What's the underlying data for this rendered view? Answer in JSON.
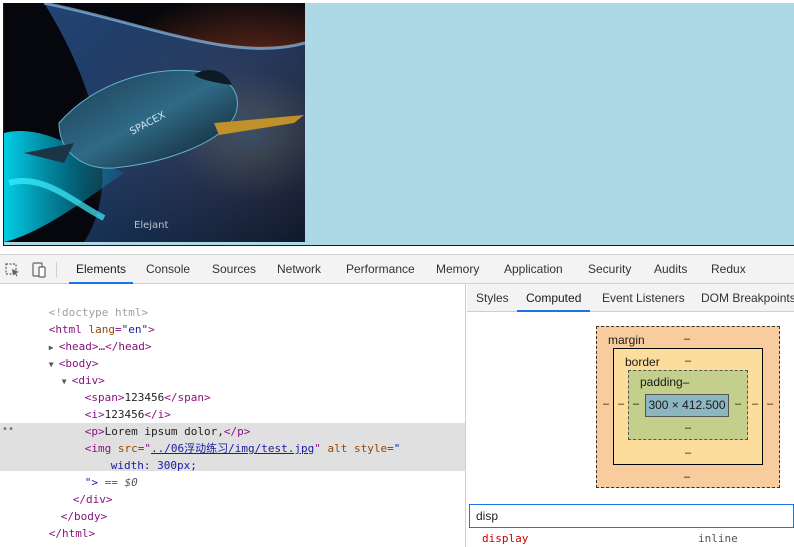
{
  "page": {
    "image_caption_text": "Elejant"
  },
  "devtools": {
    "tabs": [
      {
        "label": "Elements",
        "active": true
      },
      {
        "label": "Console",
        "active": false
      },
      {
        "label": "Sources",
        "active": false
      },
      {
        "label": "Network",
        "active": false
      },
      {
        "label": "Performance",
        "active": false
      },
      {
        "label": "Memory",
        "active": false
      },
      {
        "label": "Application",
        "active": false
      },
      {
        "label": "Security",
        "active": false
      },
      {
        "label": "Audits",
        "active": false
      },
      {
        "label": "Redux",
        "active": false
      }
    ],
    "icons": {
      "inspect": "inspect-element-icon",
      "device": "device-toolbar-icon"
    },
    "accent_color": "#1a73e8"
  },
  "elements": {
    "doctype": "<!doctype html>",
    "html_open_tag": "html",
    "html_lang_attr": "lang",
    "html_lang_val": "\"en\"",
    "head_collapsed": "<head>…</head>",
    "body_open": "<body>",
    "div_open": "<div>",
    "span_line": {
      "open": "<span>",
      "text": "123456",
      "close": "</span>"
    },
    "i_line": {
      "open": "<i>",
      "text": "123456",
      "close": "</i>"
    },
    "p_line": {
      "open": "<p>",
      "text": "Lorem ipsum dolor,",
      "close": "</p>"
    },
    "img_line": {
      "open": "<img",
      "src_attr": "src",
      "src_val": "../06浮动练习/img/test.jpg",
      "alt_attr": "alt",
      "style_attr": "style",
      "style_val_open": "\"",
      "style_body": "width: 300px;",
      "style_close": "\">",
      "selected_marker": "== $0"
    },
    "div_close": "</div>",
    "body_close": "</body>",
    "html_close": "</html>"
  },
  "sidebar": {
    "tabs": [
      {
        "label": "Styles",
        "active": false
      },
      {
        "label": "Computed",
        "active": true
      },
      {
        "label": "Event Listeners",
        "active": false
      },
      {
        "label": "DOM Breakpoints",
        "active": false
      }
    ],
    "box_model": {
      "margin_label": "margin",
      "border_label": "border",
      "padding_label": "padding–",
      "content": "300 × 412.500",
      "margin_top": "–",
      "margin_bottom": "–",
      "margin_left": "–",
      "margin_right": "–",
      "border_top": "–",
      "border_bottom": "–",
      "border_left": "–",
      "border_right": "–",
      "padding_bottom": "–",
      "padding_left": "–",
      "padding_right": "–",
      "colors": {
        "margin": "#f9cc9d",
        "border": "#fddd9b",
        "padding": "#c3cf8a",
        "content": "#8cb6c0"
      }
    },
    "filter": {
      "value": "disp"
    },
    "property": {
      "name": "display",
      "value": "inline"
    }
  }
}
